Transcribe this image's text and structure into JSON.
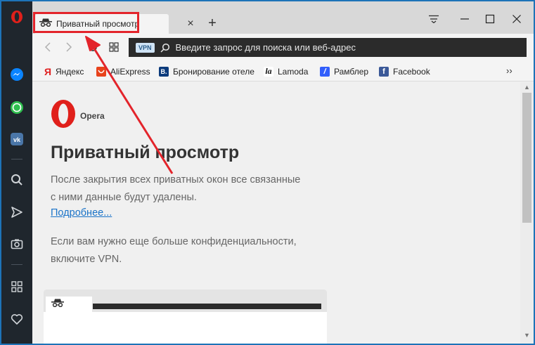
{
  "tab": {
    "title": "Приватный просмотр",
    "close": "×",
    "new": "+"
  },
  "address": {
    "vpn": "VPN",
    "placeholder": "Введите запрос для поиска или веб-адрес"
  },
  "bookmarks": [
    {
      "label": "Яндекс",
      "icon": "Я",
      "color": "#e02020",
      "text_color": "#e02020"
    },
    {
      "label": "AliExpress",
      "icon": "",
      "color": "#e8431c"
    },
    {
      "label": "Бронирование отеле",
      "icon": "B.",
      "color": "#0c3b7c"
    },
    {
      "label": "Lamoda",
      "icon": "la",
      "color": "#111111"
    },
    {
      "label": "Рамблер",
      "icon": "/",
      "color": "#315efb"
    },
    {
      "label": "Facebook",
      "icon": "f",
      "color": "#3b5998"
    }
  ],
  "bookmarks_more": "››",
  "page": {
    "brand": "Opera",
    "title": "Приватный просмотр",
    "para1_line1": "После закрытия всех приватных окон все связанные",
    "para1_line2": "с ними данные будут удалены.",
    "link": "Подробнее...",
    "para2_line1": "Если вам нужно еще больше конфиденциальности,",
    "para2_line2": "включите VPN."
  },
  "colors": {
    "sidebar": "#1f262d",
    "opera_red": "#e0201b",
    "annotation_red": "#e3242b",
    "link": "#1a73c8"
  },
  "sidebar_icons": [
    "opera-logo-icon",
    "messenger-icon",
    "whatsapp-icon",
    "vk-icon",
    "search-icon",
    "send-icon",
    "camera-icon",
    "apps-icon",
    "heart-icon"
  ]
}
